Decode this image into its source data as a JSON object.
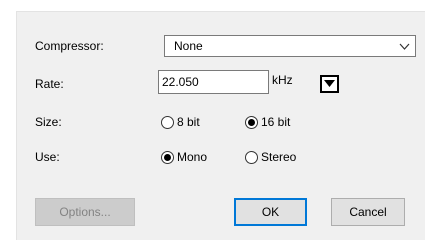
{
  "form": {
    "compressor_label": "Compressor:",
    "compressor_value": "None",
    "rate_label": "Rate:",
    "rate_value": "22.050",
    "rate_unit": "kHz",
    "size_label": "Size:",
    "size_options": [
      "8 bit",
      "16 bit"
    ],
    "size_selected": "16 bit",
    "use_label": "Use:",
    "use_options": [
      "Mono",
      "Stereo"
    ],
    "use_selected": "Mono"
  },
  "buttons": {
    "options": "Options...",
    "ok": "OK",
    "cancel": "Cancel"
  },
  "icons": {
    "compressor_dropdown": "chevron-down-icon",
    "rate_dropdown": "triangle-down-icon"
  },
  "colors": {
    "dialog_background": "#f0f0f0",
    "default_button_border": "#0078d7"
  }
}
